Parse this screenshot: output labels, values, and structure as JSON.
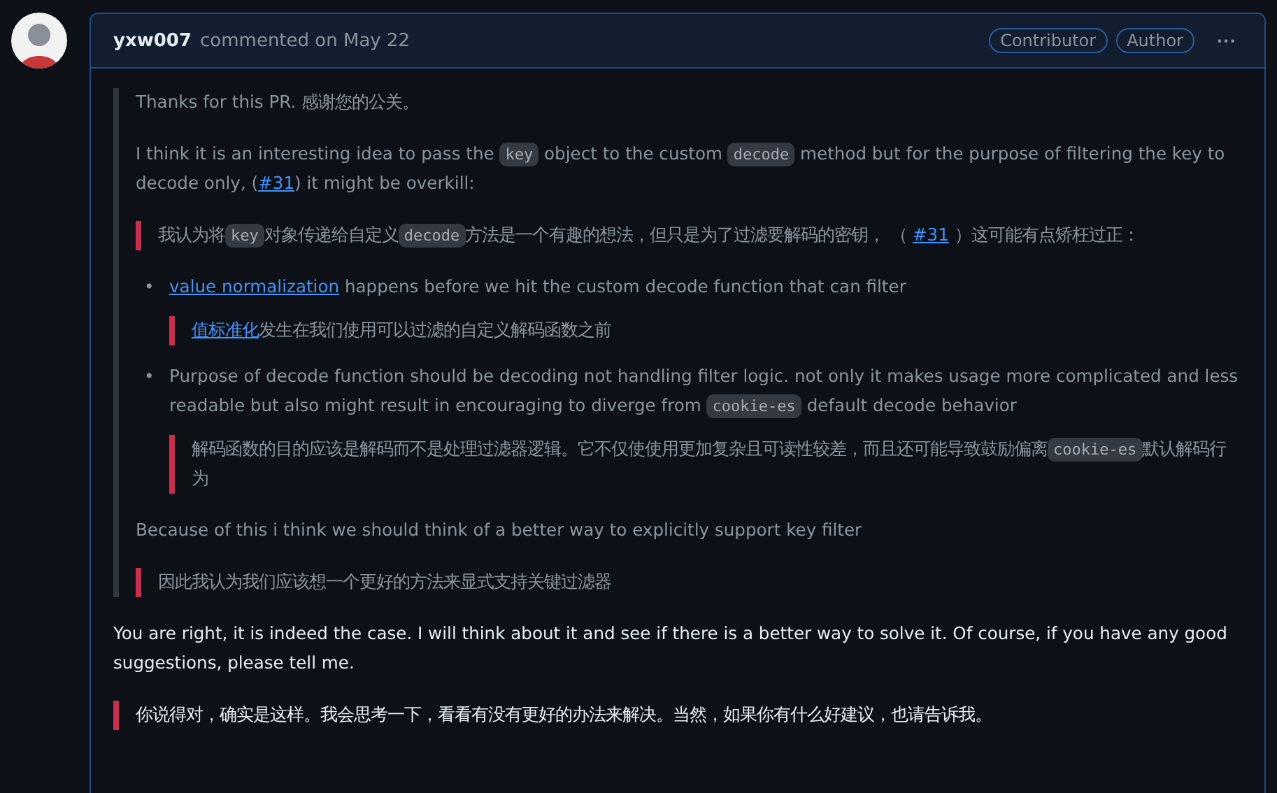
{
  "comment": {
    "author": "yxw007",
    "action": "commented on May 22",
    "badges": [
      "Contributor",
      "Author"
    ],
    "menu": "···",
    "quote": [
      {
        "kind": "para",
        "parts": [
          {
            "kind": "text",
            "text": "Thanks for this PR. 感谢您的公关。"
          }
        ]
      },
      {
        "kind": "para",
        "parts": [
          {
            "kind": "text",
            "text": "I think it is an interesting idea to pass the "
          },
          {
            "kind": "code",
            "text": "key"
          },
          {
            "kind": "text",
            "text": " object to the custom "
          },
          {
            "kind": "code",
            "text": "decode"
          },
          {
            "kind": "text",
            "text": " method but for the purpose of filtering the key to decode only, ("
          },
          {
            "kind": "link",
            "text": "#31"
          },
          {
            "kind": "text",
            "text": ") it might be overkill:"
          }
        ]
      },
      {
        "kind": "translation",
        "parts": [
          {
            "kind": "text",
            "text": "我认为将"
          },
          {
            "kind": "code",
            "text": "key"
          },
          {
            "kind": "text",
            "text": "对象传递给自定义"
          },
          {
            "kind": "code",
            "text": "decode"
          },
          {
            "kind": "text",
            "text": "方法是一个有趣的想法，但只是为了过滤要解码的密钥， （ "
          },
          {
            "kind": "link",
            "text": "#31"
          },
          {
            "kind": "text",
            "text": " ）这可能有点矫枉过正："
          }
        ]
      },
      {
        "kind": "bullet",
        "marker": "•",
        "parts": [
          {
            "kind": "link",
            "text": "value normalization"
          },
          {
            "kind": "text",
            "text": " happens before we hit the custom decode function that can filter"
          }
        ],
        "translation": [
          {
            "kind": "link",
            "text": "值标准化"
          },
          {
            "kind": "text",
            "text": "发生在我们使用可以过滤的自定义解码函数之前"
          }
        ]
      },
      {
        "kind": "bullet",
        "marker": "•",
        "parts": [
          {
            "kind": "text",
            "text": "Purpose of decode function should be decoding not handling filter logic. not only it makes usage more complicated and less readable but also might result in encouraging to diverge from "
          },
          {
            "kind": "code",
            "text": "cookie-es"
          },
          {
            "kind": "text",
            "text": " default decode behavior"
          }
        ],
        "translation": [
          {
            "kind": "text",
            "text": "解码函数的目的应该是解码而不是处理过滤器逻辑。它不仅使使用更加复杂且可读性较差，而且还可能导致鼓励偏离"
          },
          {
            "kind": "code",
            "text": "cookie-es"
          },
          {
            "kind": "text",
            "text": "默认解码行为"
          }
        ]
      },
      {
        "kind": "para",
        "parts": [
          {
            "kind": "text",
            "text": "Because of this i think we should think of a better way to explicitly support key filter"
          }
        ]
      },
      {
        "kind": "translation",
        "parts": [
          {
            "kind": "text",
            "text": "因此我认为我们应该想一个更好的方法来显式支持关键过滤器"
          }
        ]
      }
    ],
    "reply": [
      {
        "kind": "para",
        "parts": [
          {
            "kind": "text",
            "text": "You are right, it is indeed the case. I will think about it and see if there is a better way to solve it. Of course, if you have any good suggestions, please tell me."
          }
        ]
      },
      {
        "kind": "translation",
        "parts": [
          {
            "kind": "text",
            "text": "你说得对，确实是这样。我会思考一下，看看有没有更好的办法来解决。当然，如果你有什么好建议，也请告诉我。"
          }
        ]
      }
    ]
  }
}
